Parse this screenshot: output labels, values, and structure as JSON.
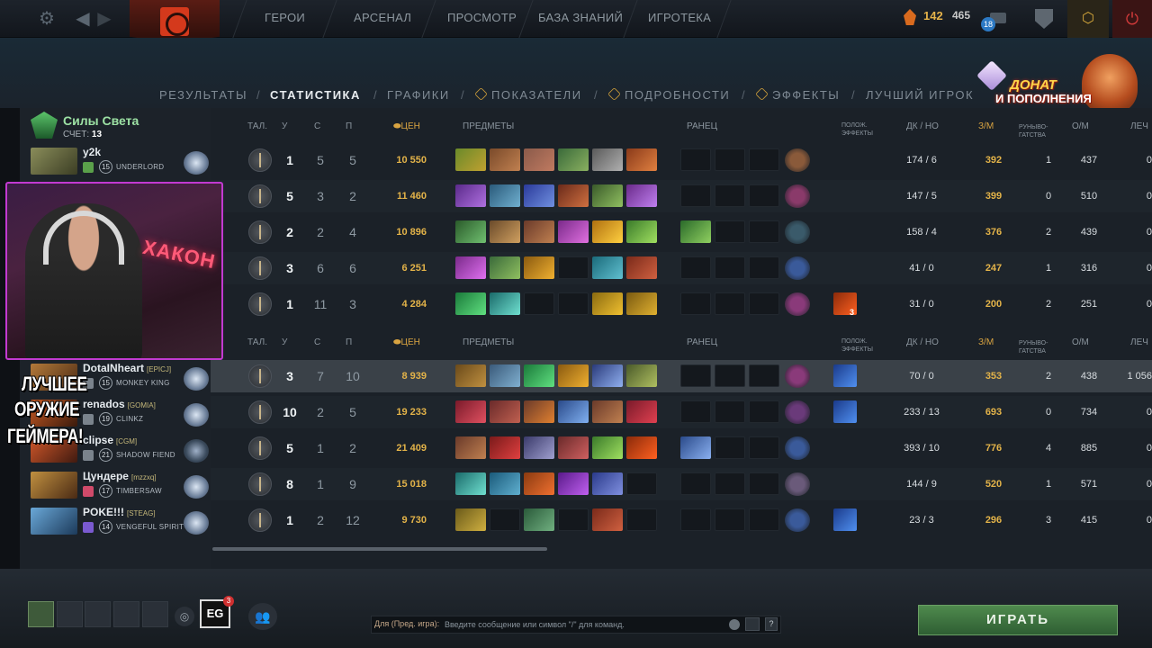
{
  "topbar": {
    "nav": [
      "ГЕРОИ",
      "АРСЕНАЛ",
      "ПРОСМОТР",
      "БАЗА ЗНАНИЙ",
      "ИГРОТЕКА"
    ],
    "shards": "142",
    "coins": "465",
    "notifications": "18"
  },
  "subnav": {
    "results": "РЕЗУЛЬТАТЫ",
    "stats": "СТАТИСТИКА",
    "graphs": "ГРАФИКИ",
    "metrics": "ПОКАЗАТЕЛИ",
    "details": "ПОДРОБНОСТИ",
    "effects": "ЭФФЕКТЫ",
    "best_player": "ЛУЧШИЙ ИГРОК"
  },
  "donate": {
    "line1": "ДОНАТ",
    "line2": "И ПОПОЛНЕНИЯ"
  },
  "radiant": {
    "title": "Силы Света",
    "score_label": "СЧЕТ:",
    "score": "13"
  },
  "overlay": {
    "line1": "ЛУЧШЕЕ",
    "line2": "ОРУЖИЕ",
    "line3": "ГЕЙМЕРА!",
    "neon": "ХАКОН"
  },
  "headers": {
    "talent": "ТАЛ.",
    "kills": "У",
    "deaths": "С",
    "assists": "П",
    "networth": "ЦЕН",
    "items": "ПРЕДМЕТЫ",
    "backpack": "РАНЕЦ",
    "buffs_1": "ПОЛОЖ.",
    "buffs_2": "ЭФФЕКТЫ",
    "lh_dn": "ДК / НО",
    "gpm": "З/М",
    "runes_1": "РУНЫВО-",
    "runes_2": "ГАТСТВА",
    "xpm": "О/М",
    "heal": "ЛЕЧ"
  },
  "players_radiant": [
    {
      "name": "y2k",
      "tag": "",
      "level": "15",
      "hero": "UNDERLORD",
      "k": "1",
      "d": "5",
      "a": "5",
      "nw": "10 550",
      "lh": "174",
      "dn": "6",
      "gpm": "392",
      "runes": "1",
      "xpm": "437",
      "heal": "0"
    },
    {
      "name": "",
      "tag": "",
      "level": "",
      "hero": "",
      "k": "5",
      "d": "3",
      "a": "2",
      "nw": "11 460",
      "lh": "147",
      "dn": "5",
      "gpm": "399",
      "runes": "0",
      "xpm": "510",
      "heal": "0"
    },
    {
      "name": "",
      "tag": "",
      "level": "",
      "hero": "",
      "k": "2",
      "d": "2",
      "a": "4",
      "nw": "10 896",
      "lh": "158",
      "dn": "4",
      "gpm": "376",
      "runes": "2",
      "xpm": "439",
      "heal": "0"
    },
    {
      "name": "",
      "tag": "",
      "level": "",
      "hero": "",
      "k": "3",
      "d": "6",
      "a": "6",
      "nw": "6 251",
      "lh": "41",
      "dn": "0",
      "gpm": "247",
      "runes": "1",
      "xpm": "316",
      "heal": "0"
    },
    {
      "name": "",
      "tag": "",
      "level": "",
      "hero": "",
      "k": "1",
      "d": "11",
      "a": "3",
      "nw": "4 284",
      "lh": "31",
      "dn": "0",
      "gpm": "200",
      "runes": "2",
      "xpm": "251",
      "heal": "0",
      "buff_count": "3"
    }
  ],
  "players_dire": [
    {
      "name": "DotaINheart",
      "tag": "[EPICJ]",
      "level": "15",
      "hero": "MONKEY KING",
      "k": "3",
      "d": "7",
      "a": "10",
      "nw": "8 939",
      "lh": "70",
      "dn": "0",
      "gpm": "353",
      "runes": "2",
      "xpm": "438",
      "heal": "1 056"
    },
    {
      "name": "renados",
      "tag": "[GOMIA]",
      "level": "19",
      "hero": "CLINKZ",
      "k": "10",
      "d": "2",
      "a": "5",
      "nw": "19 233",
      "lh": "233",
      "dn": "13",
      "gpm": "693",
      "runes": "0",
      "xpm": "734",
      "heal": "0"
    },
    {
      "name": "clipse",
      "tag": "[CGM]",
      "level": "21",
      "hero": "SHADOW FIEND",
      "k": "5",
      "d": "1",
      "a": "2",
      "nw": "21 409",
      "lh": "393",
      "dn": "10",
      "gpm": "776",
      "runes": "4",
      "xpm": "885",
      "heal": "0"
    },
    {
      "name": "Цундере",
      "tag": "[mzzxq]",
      "level": "17",
      "hero": "TIMBERSAW",
      "k": "8",
      "d": "1",
      "a": "9",
      "nw": "15 018",
      "lh": "144",
      "dn": "9",
      "gpm": "520",
      "runes": "1",
      "xpm": "571",
      "heal": "0"
    },
    {
      "name": "POKE!!!",
      "tag": "[STEAG]",
      "level": "14",
      "hero": "VENGEFUL SPIRIT",
      "k": "1",
      "d": "2",
      "a": "12",
      "nw": "9 730",
      "lh": "23",
      "dn": "3",
      "gpm": "296",
      "runes": "3",
      "xpm": "415",
      "heal": "0"
    }
  ],
  "bottom": {
    "eg": "EG",
    "eg_count": "3",
    "chat_label": "Для (Пред. игра):",
    "chat_placeholder": "Введите сообщение или символ \"/\" для команд.",
    "help": "?",
    "play": "ИГРАТЬ"
  },
  "colors": {
    "radiant": "#9de2a4",
    "gold": "#e3b349",
    "play": "#3f7a41",
    "selected_row": "#3a4148"
  }
}
